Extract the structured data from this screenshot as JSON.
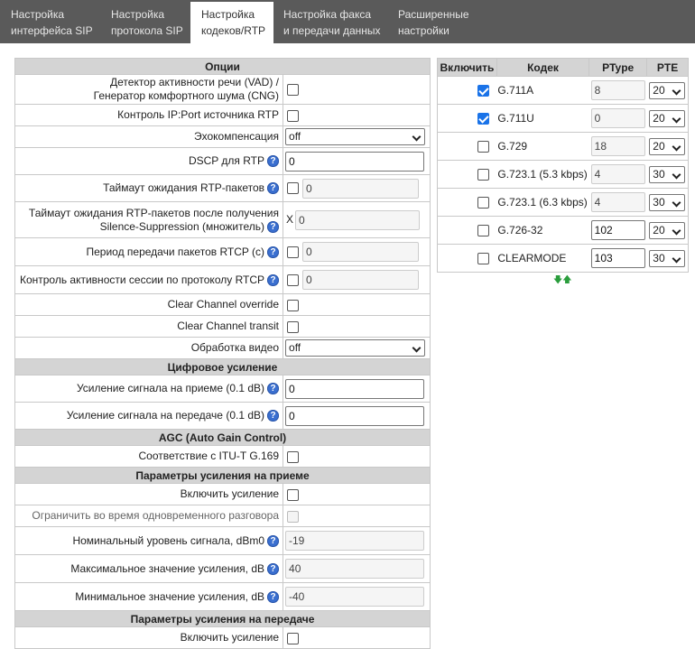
{
  "tabs": [
    {
      "line1": "Настройка",
      "line2": "интерфейса SIP"
    },
    {
      "line1": "Настройка",
      "line2": "протокола SIP"
    },
    {
      "line1": "Настройка",
      "line2": "кодеков/RTP"
    },
    {
      "line1": "Настройка факса",
      "line2": "и передачи данных"
    },
    {
      "line1": "Расширенные",
      "line2": "настройки"
    }
  ],
  "active_tab": 2,
  "options": {
    "header": "Опции",
    "vad": "Детектор активности речи (VAD) / Генератор комфортного шума (CNG)",
    "rtp_src": "Контроль IP:Port источника RTP",
    "echo": "Эхокомпенсация",
    "echo_value": "off",
    "dscp": "DSCP для RTP",
    "dscp_value": "0",
    "rtp_timeout": "Таймаут ожидания RTP-пакетов",
    "rtp_timeout_value": "0",
    "ss_timeout": "Таймаут ожидания RTP-пакетов после получения Silence-Suppression (множитель)",
    "ss_prefix": "X",
    "ss_timeout_value": "0",
    "rtcp_period": "Период передачи пакетов RTCP (с)",
    "rtcp_period_value": "0",
    "rtcp_ctrl": "Контроль активности сессии по протоколу RTCP",
    "rtcp_ctrl_value": "0",
    "cc_override": "Clear Channel override",
    "cc_transit": "Clear Channel transit",
    "video": "Обработка видео",
    "video_value": "off"
  },
  "digital_gain": {
    "header": "Цифровое усиление",
    "rx": "Усиление сигнала на приеме (0.1 dB)",
    "rx_value": "0",
    "tx": "Усиление сигнала на передаче (0.1 dB)",
    "tx_value": "0"
  },
  "agc": {
    "header": "AGC (Auto Gain Control)",
    "g169": "Соответствие с ITU-T G.169"
  },
  "rx_gain": {
    "header": "Параметры усиления на приеме",
    "enable": "Включить усиление",
    "limit": "Ограничить во время одновременного разговора",
    "nominal": "Номинальный уровень сигнала, dBm0",
    "nominal_value": "-19",
    "max": "Максимальное значение усиления, dB",
    "max_value": "40",
    "min": "Минимальное значение усиления, dB",
    "min_value": "-40"
  },
  "tx_gain": {
    "header": "Параметры усиления на передаче",
    "enable": "Включить усиление"
  },
  "codecs": {
    "headers": {
      "enable": "Включить",
      "codec": "Кодек",
      "ptype": "PType",
      "pte": "PTE"
    },
    "rows": [
      {
        "enabled": true,
        "name": "G.711A",
        "ptype": "8",
        "pte": "20"
      },
      {
        "enabled": true,
        "name": "G.711U",
        "ptype": "0",
        "pte": "20"
      },
      {
        "enabled": false,
        "name": "G.729",
        "ptype": "18",
        "pte": "20"
      },
      {
        "enabled": false,
        "name": "G.723.1 (5.3 kbps)",
        "ptype": "4",
        "pte": "30"
      },
      {
        "enabled": false,
        "name": "G.723.1 (6.3 kbps)",
        "ptype": "4",
        "pte": "30"
      },
      {
        "enabled": false,
        "name": "G.726-32",
        "ptype": "102",
        "pte": "20"
      },
      {
        "enabled": false,
        "name": "CLEARMODE",
        "ptype": "103",
        "pte": "30"
      }
    ],
    "sort_arrows": "🡇🡅"
  },
  "colors": {
    "tabbar": "#5a5a5a",
    "header_bg": "#d4d4d4",
    "help_icon": "#3a6fd0",
    "checked": "#1a73e8",
    "arrows": "#2a9d3c"
  }
}
